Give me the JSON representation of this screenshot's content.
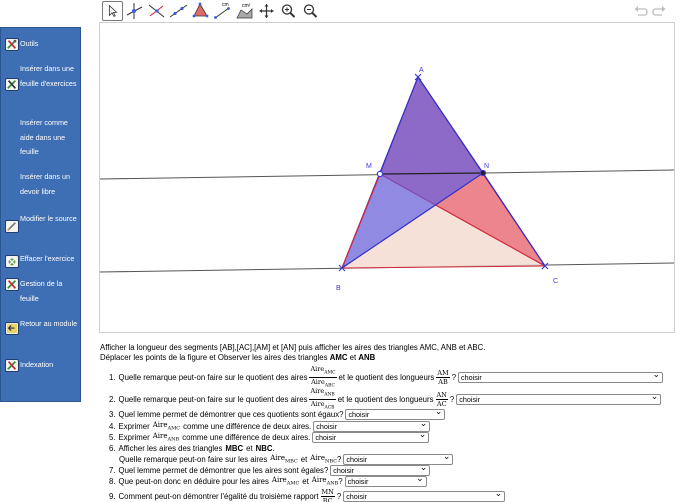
{
  "sidebar": {
    "items": [
      {
        "label": "Outils",
        "icon": "tools-icon"
      },
      {
        "label": "Insérer dans une feuille d'exercices",
        "icon": "insert-sheet-icon"
      },
      {
        "label": "Insérer comme aide dans une feuille",
        "icon": ""
      },
      {
        "label": "Insérer dans un devoir libre",
        "icon": ""
      },
      {
        "label": "Modifier le source",
        "icon": "edit-source-icon"
      },
      {
        "label": "Effacer l'exercice",
        "icon": "erase-icon"
      },
      {
        "label": "Gestion de la feuille",
        "icon": "sheet-management-icon"
      },
      {
        "label": "Retour au module",
        "icon": "return-icon"
      },
      {
        "label": "Indexation",
        "icon": "indexation-icon"
      }
    ]
  },
  "toolbar": {
    "tools": [
      "move-tool",
      "point-tool",
      "perpendicular-tool",
      "line-tool",
      "polygon-tool",
      "distance-tool",
      "area-tool",
      "move-graphics-tool",
      "zoom-in-tool",
      "zoom-out-tool"
    ],
    "distance_label": "cm",
    "area_label": "cm²",
    "undo": "undo-icon",
    "redo": "redo-icon"
  },
  "figure": {
    "points": {
      "A": "A",
      "M": "M",
      "N": "N",
      "B": "B",
      "C": "C"
    },
    "colors": {
      "amc": "#e8495a",
      "anb": "#5b5be8",
      "abc_fill": "#f2d4c8",
      "amn": "#7a45c8",
      "line": "#555555"
    }
  },
  "instructions": {
    "line1": "Afficher la longueur des segments [AB],[AC],[AM] et [AN] puis afficher les aires des triangles AMC, ANB et ABC.",
    "line2a": "Déplacer les points de la figure et Observer les aires des triangles",
    "line2b": "AMC",
    "line2c": "et",
    "line2d": "ANB"
  },
  "questions": [
    {
      "num": "1.",
      "pre": "Quelle remarque peut-on faire sur le quotient des aires",
      "frac1_num": "Aire",
      "frac1_num_sub": "AMC",
      "frac1_den": "Aire",
      "frac1_den_sub": "ABC",
      "mid": "et le quotient des longueurs",
      "frac2_num": "AM",
      "frac2_den": "AB",
      "post": "?",
      "select": "choisir"
    },
    {
      "num": "2.",
      "pre": "Quelle remarque peut-on faire sur le quotient des aires",
      "frac1_num": "Aire",
      "frac1_num_sub": "ANB",
      "frac1_den": "Aire",
      "frac1_den_sub": "ACB",
      "mid": "et le quotient des longueurs",
      "frac2_num": "AN",
      "frac2_den": "AC",
      "post": "?",
      "select": "choisir"
    },
    {
      "num": "3.",
      "text": "Quel lemme permet de démontrer que ces quotients sont égaux?",
      "select": "choisir"
    },
    {
      "num": "4.",
      "pre": "Exprimer",
      "math": "Aire",
      "math_sub": "AMC",
      "post": "comme une différence de deux aires.",
      "select": "choisir"
    },
    {
      "num": "5.",
      "pre": "Exprimer",
      "math": "Aire",
      "math_sub": "ANB",
      "post": "comme une différence de deux aires.",
      "select": "choisir"
    },
    {
      "num": "6.",
      "text_a": "Afficher les aires des triangles",
      "text_b": "MBC",
      "text_c": "et",
      "text_d": "NBC",
      "text_e": ".",
      "sub_pre": "Quelle remarque peut-on faire sur les aires",
      "sub_math1": "Aire",
      "sub_math1_sub": "MBC",
      "sub_mid": "et",
      "sub_math2": "Aire",
      "sub_math2_sub": "NBC",
      "sub_post": "?",
      "select": "choisir"
    },
    {
      "num": "7.",
      "text": "Quel lemme permet de démontrer que les aires sont égales?",
      "select": "choisir"
    },
    {
      "num": "8.",
      "pre": "Que peut-on donc en déduire pour les aires",
      "math1": "Aire",
      "math1_sub": "AMC",
      "mid": "et",
      "math2": "Aire",
      "math2_sub": "ANB",
      "post": "?",
      "select": "choisir"
    },
    {
      "num": "9.",
      "pre": "Comment peut-on démontrer l'égalité du troisième rapport",
      "frac_num": "MN",
      "frac_den": "BC",
      "post": "?",
      "select": "choisir"
    }
  ]
}
